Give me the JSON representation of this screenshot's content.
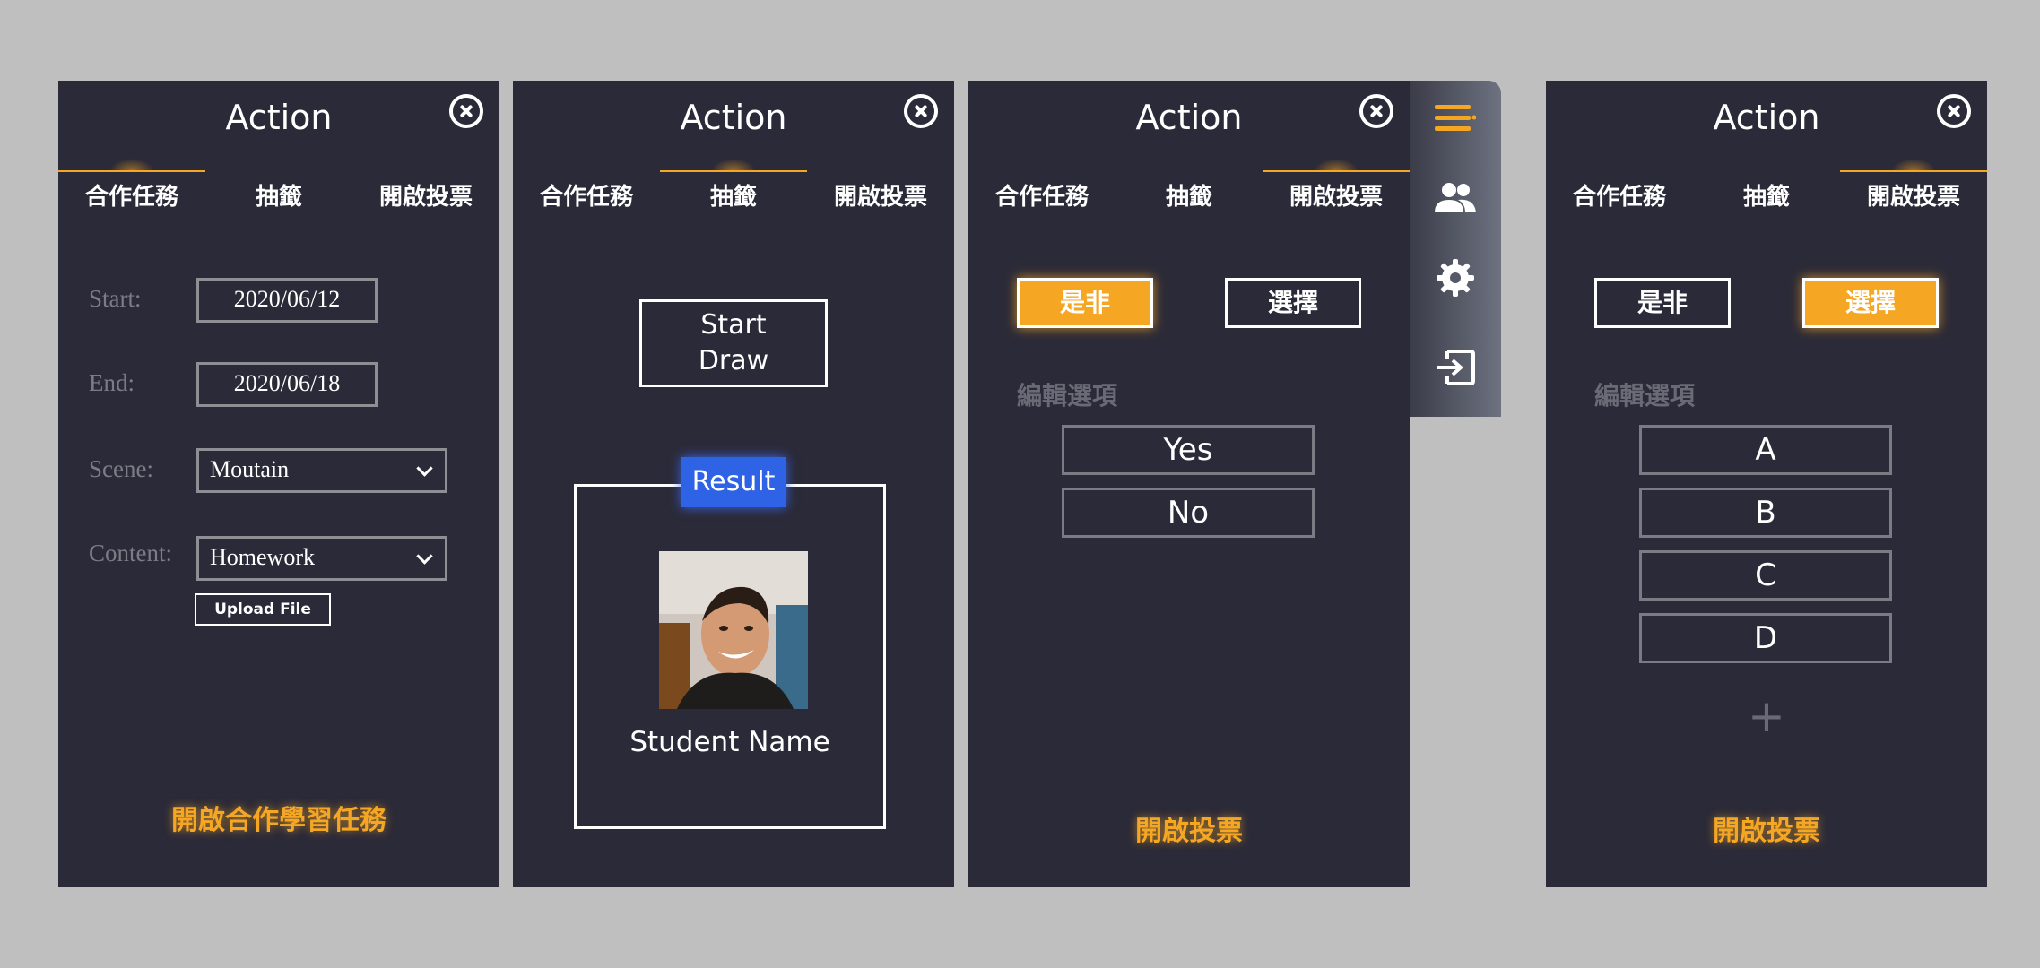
{
  "panels": {
    "p1": {
      "title": "Action",
      "tabs": [
        "合作任務",
        "抽籤",
        "開啟投票"
      ],
      "form": {
        "start_label": "Start:",
        "start_value": "2020/06/12",
        "end_label": "End:",
        "end_value": "2020/06/18",
        "scene_label": "Scene:",
        "scene_value": "Moutain",
        "content_label": "Content:",
        "content_value": "Homework",
        "upload_label": "Upload File"
      },
      "footer": "開啟合作學習任務"
    },
    "p2": {
      "title": "Action",
      "tabs": [
        "合作任務",
        "抽籤",
        "開啟投票"
      ],
      "start_draw_line1": "Start",
      "start_draw_line2": "Draw",
      "result_label": "Result",
      "student_name": "Student Name"
    },
    "p3": {
      "title": "Action",
      "tabs": [
        "合作任務",
        "抽籤",
        "開啟投票"
      ],
      "mode_true_false": "是非",
      "mode_choice": "選擇",
      "edit_options": "編輯選項",
      "options": [
        "Yes",
        "No"
      ],
      "footer": "開啟投票"
    },
    "p4": {
      "title": "Action",
      "tabs": [
        "合作任務",
        "抽籤",
        "開啟投票"
      ],
      "mode_true_false": "是非",
      "mode_choice": "選擇",
      "edit_options": "編輯選項",
      "options": [
        "A",
        "B",
        "C",
        "D"
      ],
      "add_symbol": "+",
      "footer": "開啟投票"
    }
  },
  "side_menu": {
    "icons": [
      "menu-icon",
      "users-icon",
      "gear-icon",
      "exit-icon"
    ],
    "active_color": "#f5a623"
  },
  "colors": {
    "accent": "#f5a623",
    "panel_bg": "#2b2a38",
    "result_blue": "#2e63e6",
    "page_bg": "#bfbfbf"
  }
}
